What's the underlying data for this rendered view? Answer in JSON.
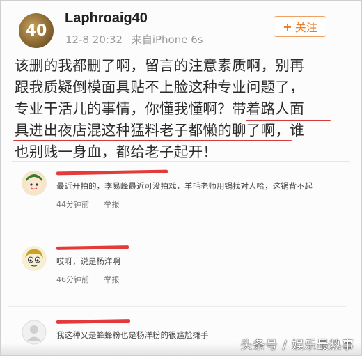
{
  "post": {
    "username": "Laphroaig40",
    "avatar_badge": "40",
    "date": "12-8 20:32",
    "source": "来自iPhone 6s",
    "follow_label": "关注",
    "lines": [
      "该删的我都删了啊，留言的注意素质啊，别再",
      "跟我质疑倒模面具贴不上脸这种专业问题了，",
      "专业干活儿的事情，你懂我懂啊？带着路人面",
      "具进出夜店混这种猛料老子都懒的聊了啊，谁",
      "也别贱一身血，都给老子起开！"
    ]
  },
  "comments": [
    {
      "text": "最近开拍的，李易峰最近可没拍戏，羊毛老师用锅找对人哈，这锅背不起",
      "time": "44分钟前",
      "report": "举报"
    },
    {
      "text": "哎呀，说是杨洋啊",
      "time": "46分钟前",
      "report": "举报"
    },
    {
      "text": "我这种又是蜂蜂粉也是杨洋粉的很尴尬摊手",
      "time": "",
      "report": ""
    }
  ],
  "watermark": "头条号 / 娱乐最热事",
  "colors": {
    "accent_red": "#d43b3b",
    "follow_orange": "#f07a20"
  }
}
